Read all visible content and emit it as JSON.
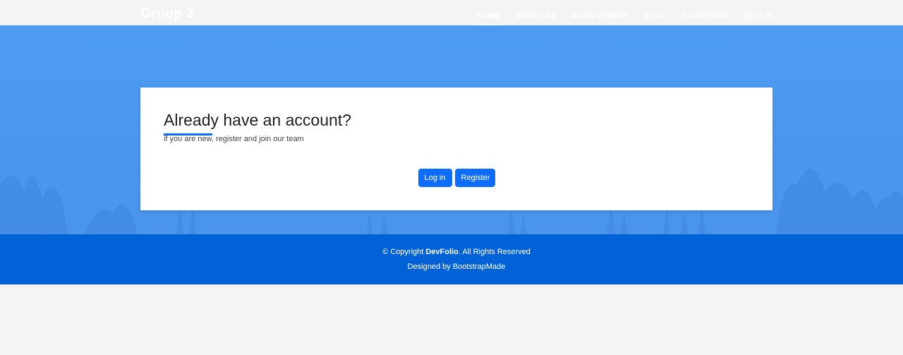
{
  "navbar": {
    "brand": "Group 2",
    "links": [
      {
        "label": "HOME",
        "active": true
      },
      {
        "label": "SERVICES",
        "active": false
      },
      {
        "label": "ACHIEVEMENT",
        "active": false
      },
      {
        "label": "BLOG",
        "active": false
      },
      {
        "label": "INVENTORY",
        "active": false
      },
      {
        "label": "SIGN IN",
        "active": false
      }
    ]
  },
  "card": {
    "title": "Already have an account?",
    "subtitle": "if you are new, register and join our team",
    "login_label": "Log in",
    "register_label": "Register"
  },
  "footer": {
    "copyright_prefix": "© Copyright ",
    "copyright_brand": "DevFolio",
    "copyright_suffix": ". All Rights Reserved",
    "credits": "Designed by BootstrapMade"
  },
  "colors": {
    "accent": "#0d6efd",
    "hero_blue": "#4a97ef",
    "footer_blue": "#0062d6",
    "page_bg": "#f4f4f4"
  }
}
